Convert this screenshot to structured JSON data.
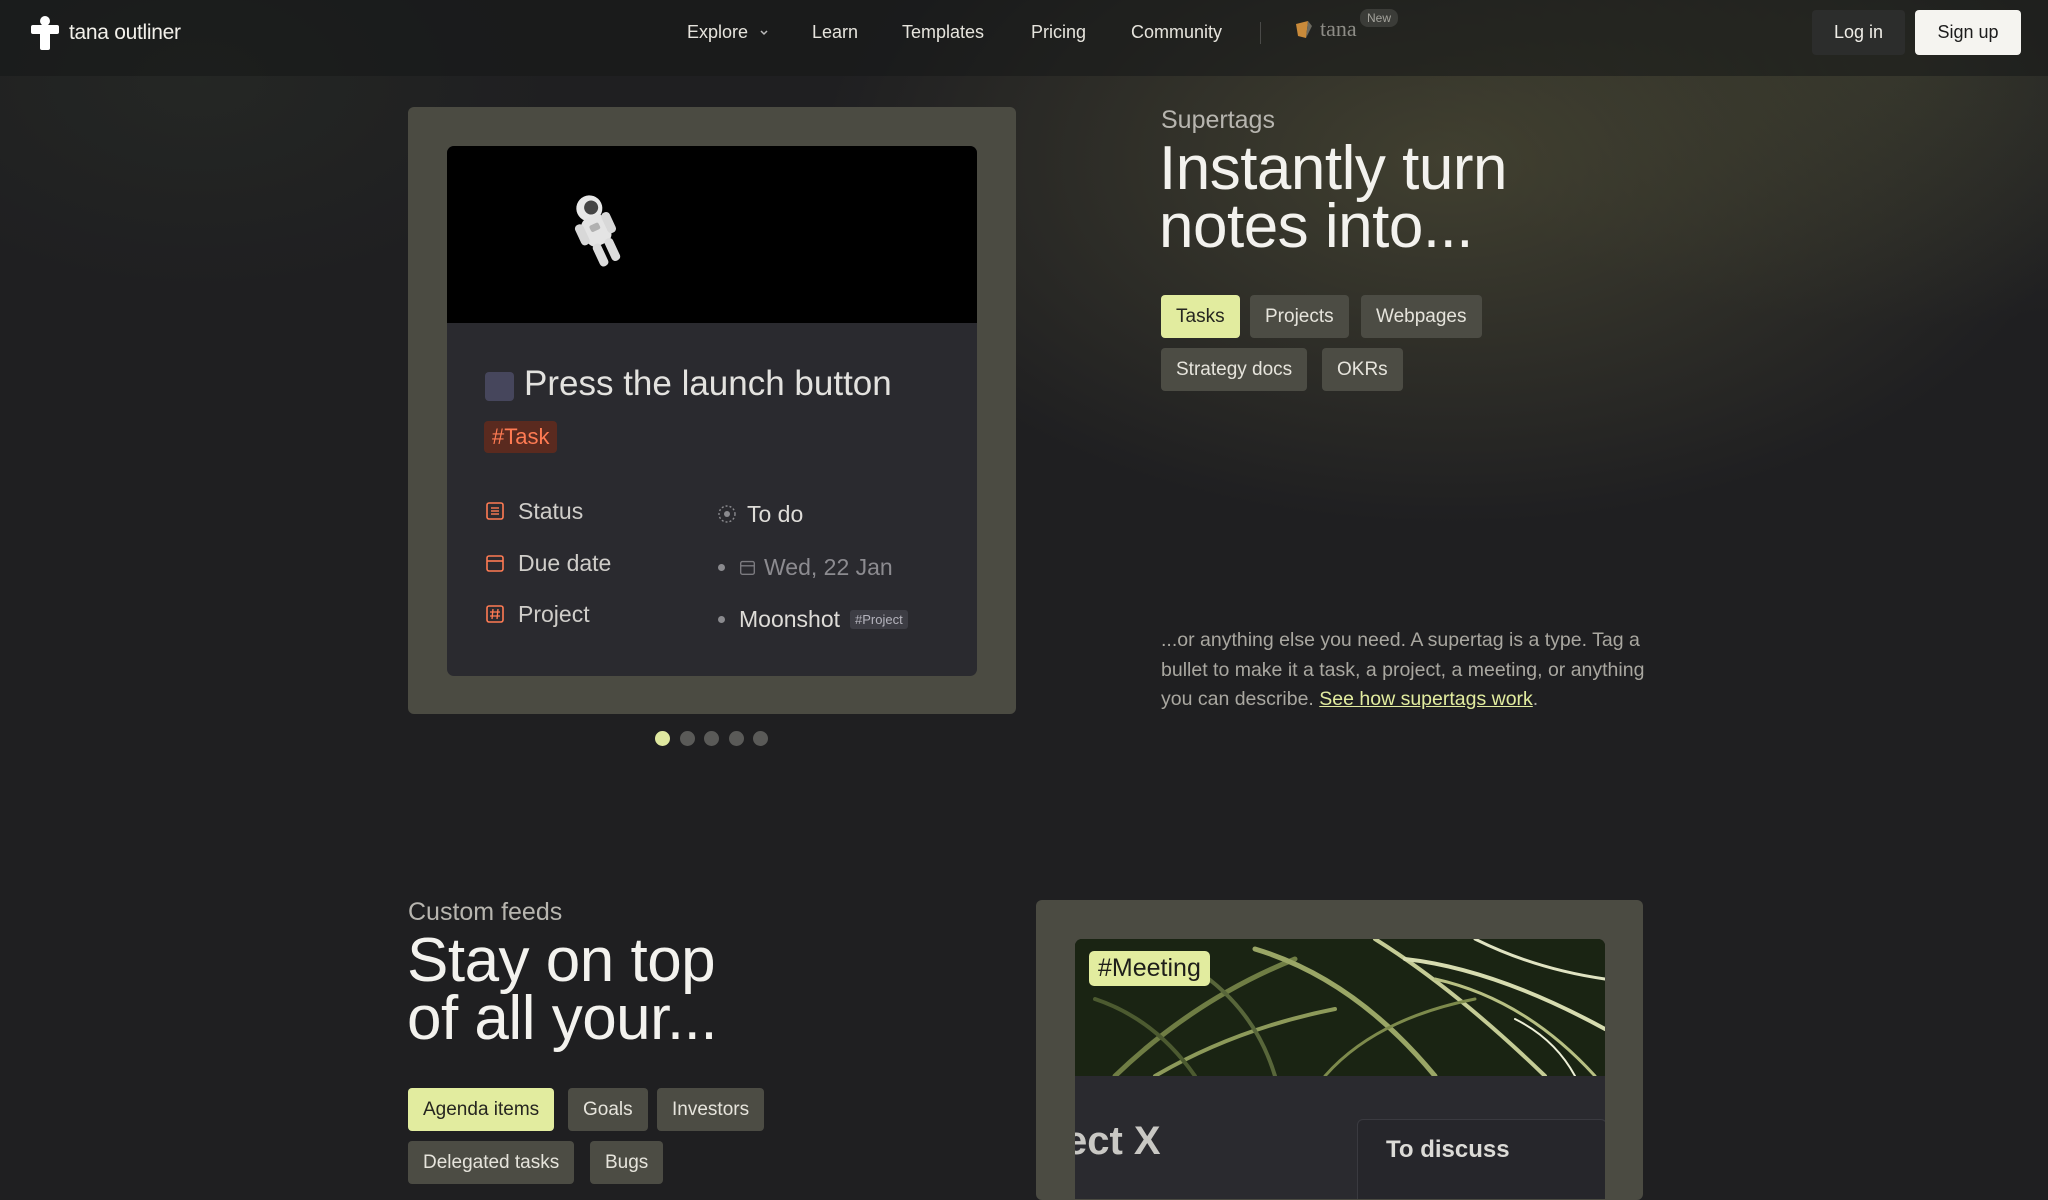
{
  "nav": {
    "logo_text": "tana outliner",
    "items": [
      "Explore",
      "Learn",
      "Templates",
      "Pricing",
      "Community"
    ],
    "tana_word": "tana",
    "new_badge": "New",
    "login": "Log in",
    "signup": "Sign up"
  },
  "supertags": {
    "eyebrow": "Supertags",
    "headline_line1": "Instantly turn",
    "headline_line2": "notes into...",
    "chips": [
      "Tasks",
      "Projects",
      "Webpages",
      "Strategy docs",
      "OKRs"
    ],
    "active_chip": "Tasks",
    "description": "...or anything else you need. A supertag is a type. Tag a bullet to make it a task, a project, a meeting, or anything you can describe. ",
    "link": "See how supertags work",
    "link_suffix": "."
  },
  "task_card": {
    "title": "Press the launch button",
    "tag": "#Task",
    "fields": [
      {
        "label": "Status",
        "value": "To do",
        "icon": "list-icon"
      },
      {
        "label": "Due date",
        "value": "Wed, 22 Jan",
        "icon": "calendar-icon"
      },
      {
        "label": "Project",
        "value": "Moonshot",
        "chip": "#Project",
        "icon": "hash-icon"
      }
    ]
  },
  "carousel": {
    "count": 5,
    "active": 0
  },
  "feeds": {
    "eyebrow": "Custom feeds",
    "headline_line1": "Stay on top",
    "headline_line2": "of all your...",
    "chips": [
      "Agenda items",
      "Goals",
      "Investors",
      "Delegated tasks",
      "Bugs"
    ],
    "active_chip": "Agenda items",
    "meeting_tag": "#Meeting",
    "project_partial": "ect X",
    "discuss": "To discuss"
  },
  "colors": {
    "accent": "#e2ec9f",
    "task_tag": "#ff7b53",
    "background": "#1f1f21"
  }
}
